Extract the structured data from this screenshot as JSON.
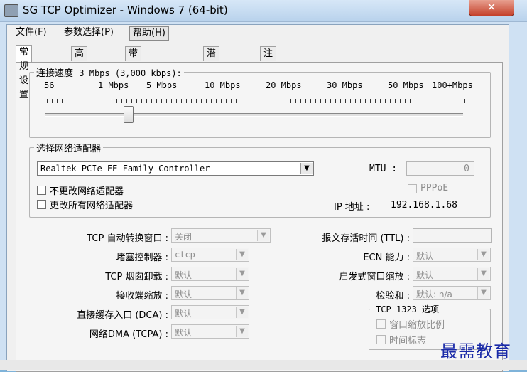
{
  "window": {
    "title": "SG TCP Optimizer - Windows 7 (64-bit)",
    "close_label": "✕"
  },
  "menu": [
    {
      "label": "文件(F)"
    },
    {
      "label": "参数选择(P)"
    },
    {
      "label": "帮助(H)"
    }
  ],
  "tabs": [
    {
      "label": "常规设置"
    },
    {
      "label": "高级设置"
    },
    {
      "label": "带宽延迟乘积"
    },
    {
      "label": "潜伏时间"
    },
    {
      "label": "注册表"
    }
  ],
  "speed": {
    "legend": "连接速度",
    "value": "3 Mbps (3,000 kbps):",
    "scale_labels": [
      "56",
      "1 Mbps",
      "5 Mbps",
      "10 Mbps",
      "20 Mbps",
      "30 Mbps",
      "50 Mbps",
      "100+Mbps"
    ]
  },
  "adapter": {
    "legend": "选择网络适配器",
    "selected": "Realtek PCIe FE Family Controller",
    "mtu_label": "MTU :",
    "mtu_value": "0",
    "pppoe_label": "PPPoE",
    "no_change_label": "不更改网络适配器",
    "change_all_label": "更改所有网络适配器",
    "ip_label": "IP 地址 :",
    "ip_value": "192.168.1.68"
  },
  "left_settings": [
    {
      "label": "TCP 自动转换窗口 :",
      "value": "关闭"
    },
    {
      "label": "堵塞控制器 :",
      "value": "ctcp"
    },
    {
      "label": "TCP 烟囱卸载 :",
      "value": "默认"
    },
    {
      "label": "接收端缩放 :",
      "value": "默认"
    },
    {
      "label": "直接缓存入口 (DCA) :",
      "value": "默认"
    },
    {
      "label": "网络DMA (TCPA) :",
      "value": "默认"
    }
  ],
  "right_settings": [
    {
      "label": "报文存活时间 (TTL) :",
      "value": ""
    },
    {
      "label": "ECN 能力 :",
      "value": "默认"
    },
    {
      "label": "启发式窗口缩放 :",
      "value": "默认"
    },
    {
      "label": "检验和 :",
      "value": "默认: n/a"
    }
  ],
  "tcp1323": {
    "legend": "TCP 1323 选项",
    "window_scale_label": "窗口缩放比例",
    "timestamps_label": "时间标志"
  },
  "watermark": "最需教育"
}
